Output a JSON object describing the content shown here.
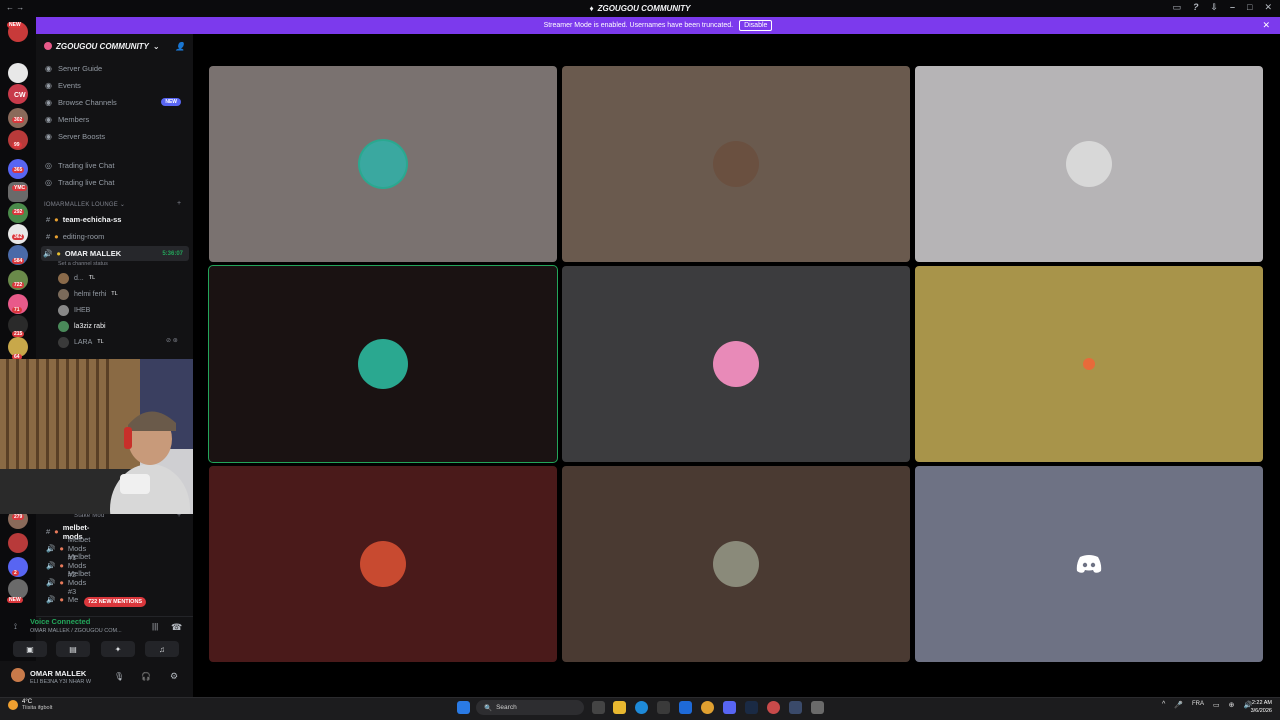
{
  "window": {
    "title": "ZGOUGOU COMMUNITY"
  },
  "banner": {
    "text": "Streamer Mode is enabled. Usernames have been truncated.",
    "button": "Disable"
  },
  "guilds": {
    "badges": [
      "NEW",
      "CW",
      "302",
      "99",
      "365",
      "YMC",
      "292",
      "362",
      "584",
      "722",
      "71",
      "215",
      "64",
      "279",
      "2",
      "NEW"
    ]
  },
  "server": {
    "name": "ZGOUGOU COMMUNITY",
    "nav": [
      {
        "label": "Server Guide",
        "icon": "guide-icon"
      },
      {
        "label": "Events",
        "icon": "calendar-icon"
      },
      {
        "label": "Browse Channels",
        "icon": "browse-icon",
        "badge": "NEW"
      },
      {
        "label": "Members",
        "icon": "members-icon"
      },
      {
        "label": "Server Boosts",
        "icon": "boost-icon"
      }
    ],
    "text_channels": [
      "Trading live Chat",
      "Trading live Chat"
    ],
    "category1": "IOMARMALLEK LOUNGE",
    "channels": [
      {
        "label": "team-echicha-ss"
      },
      {
        "label": "editing-room"
      },
      {
        "label": "OMAR MALLEK",
        "timer": "5:36:07",
        "status": "Set a channel status"
      }
    ],
    "voice_users": [
      {
        "name": "d...",
        "tag": "TL",
        "color": "#8a6a4a"
      },
      {
        "name": "helmi ferhi",
        "tag": "TL",
        "color": "#7a6a5a"
      },
      {
        "name": "IHEB",
        "tag": "",
        "color": "#888"
      },
      {
        "name": "la3ziz rabi",
        "tag": "",
        "color": "#4a8a5a"
      },
      {
        "name": "LARA",
        "tag": "TL",
        "color": "#3a3a3a"
      }
    ],
    "category2": "Stake Mod",
    "mod_channels": [
      "melbet-mods",
      "Melbet Mods #1",
      "Melbet Mods #2",
      "Melbet Mods #3",
      "Me"
    ],
    "mentions_pill": "722 NEW MENTIONS"
  },
  "voice": {
    "status": "Voice Connected",
    "channel": "OMAR MALLEK / ZGOUGOU COM..."
  },
  "user": {
    "name": "OMAR MALLEK",
    "status": "ELI BE3NA Y3I NHAR W"
  },
  "tiles": [
    {
      "bg": "#7a7270",
      "avatar": "#3aa8a0",
      "speaking": false
    },
    {
      "bg": "#6a5a4e",
      "avatar": "#6a5040",
      "speaking": false
    },
    {
      "bg": "#b6b4b6",
      "avatar": "#d8d8d8",
      "speaking": false
    },
    {
      "bg": "#1a1212",
      "avatar": "#2aa890",
      "speaking": true
    },
    {
      "bg": "#3c3c3e",
      "avatar": "#e88ab8",
      "speaking": false
    },
    {
      "bg": "#a8944a",
      "avatar": "#a8944a",
      "speaking": false
    },
    {
      "bg": "#4a1a1a",
      "avatar": "#c84a30",
      "speaking": false
    },
    {
      "bg": "#4a3a32",
      "avatar": "#8a8a7a",
      "speaking": false
    },
    {
      "bg": "#6e7284",
      "avatar": "#6e7284",
      "speaking": false,
      "discord": true
    }
  ],
  "taskbar": {
    "weather_temp": "4°C",
    "weather_desc": "Tiisita ifgbolt",
    "search": "Search",
    "lang": "FRA",
    "time": "2:22 AM",
    "date": "3/6/2026"
  }
}
